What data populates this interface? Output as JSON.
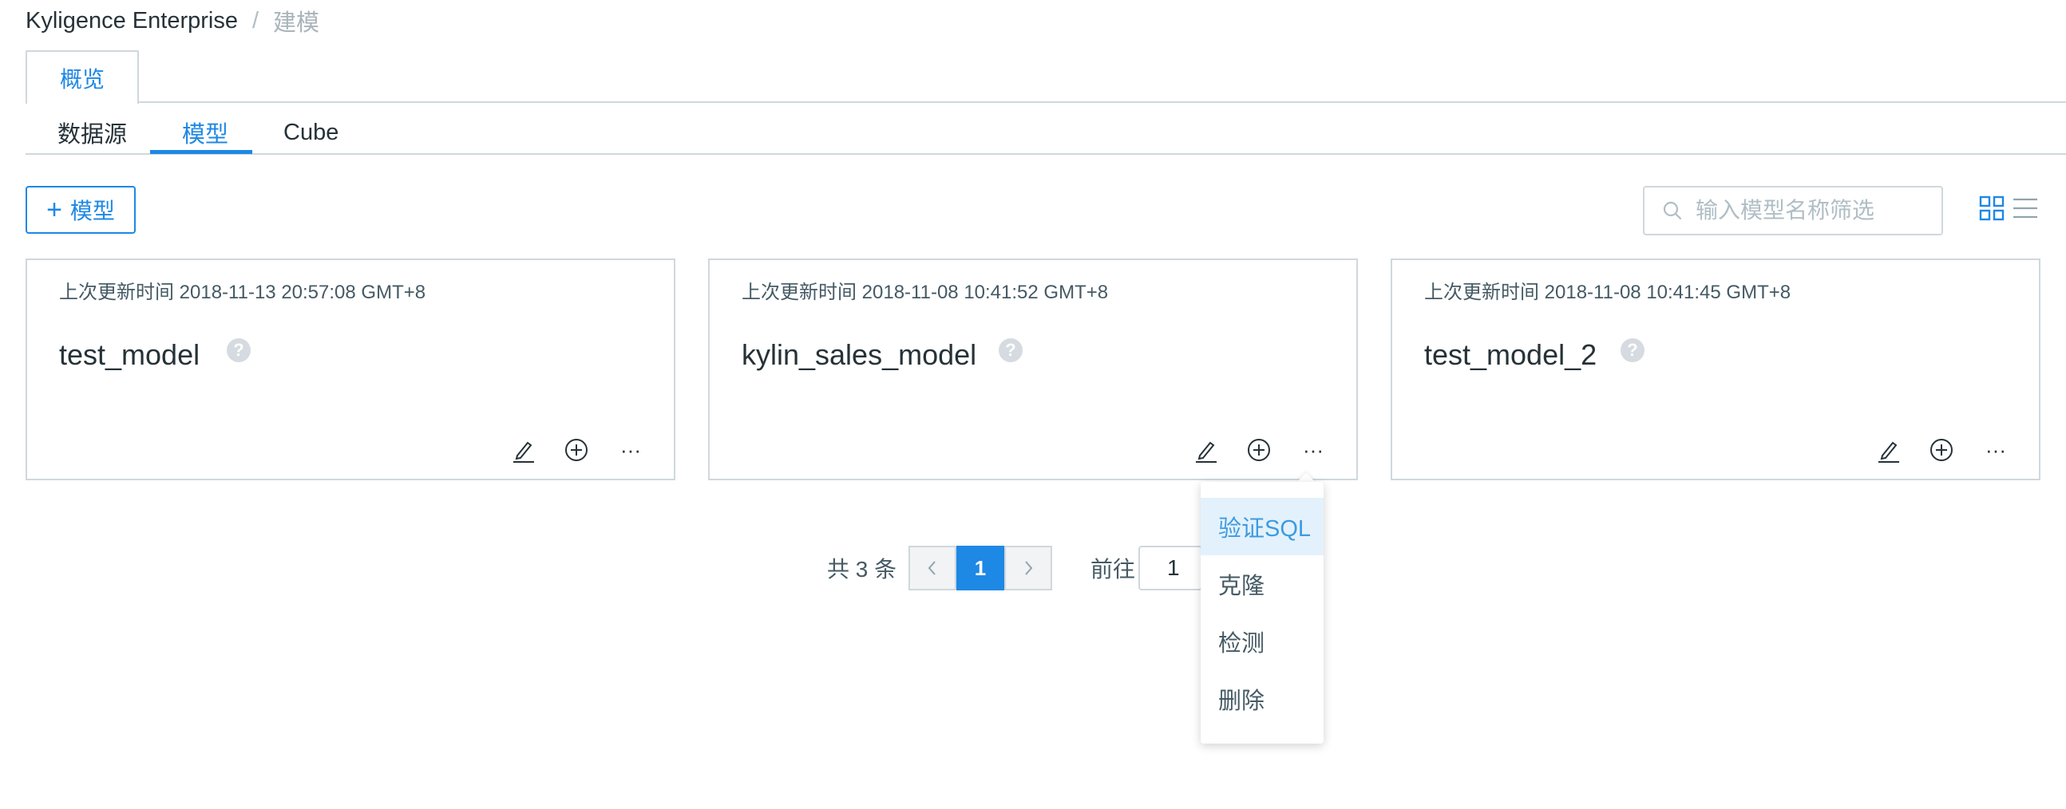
{
  "breadcrumb": {
    "root": "Kyligence Enterprise",
    "separator": "/",
    "current": "建模"
  },
  "page_tab": {
    "label": "概览"
  },
  "sub_tabs": [
    {
      "label": "数据源",
      "active": false
    },
    {
      "label": "模型",
      "active": true
    },
    {
      "label": "Cube",
      "active": false
    }
  ],
  "toolbar": {
    "add_icon": "+",
    "add_label": "模型",
    "search_placeholder": "输入模型名称筛选"
  },
  "cards": [
    {
      "time": "上次更新时间 2018-11-13 20:57:08 GMT+8",
      "name": "test_model"
    },
    {
      "time": "上次更新时间 2018-11-08 10:41:52 GMT+8",
      "name": "kylin_sales_model"
    },
    {
      "time": "上次更新时间 2018-11-08 10:41:45 GMT+8",
      "name": "test_model_2"
    }
  ],
  "card_icons": {
    "help": "?",
    "more": "···"
  },
  "pagination": {
    "total_text": "共 3 条",
    "current_page": "1",
    "goto_label": "前往",
    "goto_value": "1"
  },
  "dropdown": {
    "items": [
      "验证SQL",
      "克隆",
      "检测",
      "删除"
    ],
    "active_index": 0
  },
  "colors": {
    "accent": "#1e88e5",
    "border": "#cfd8dc",
    "text": "#263238"
  }
}
